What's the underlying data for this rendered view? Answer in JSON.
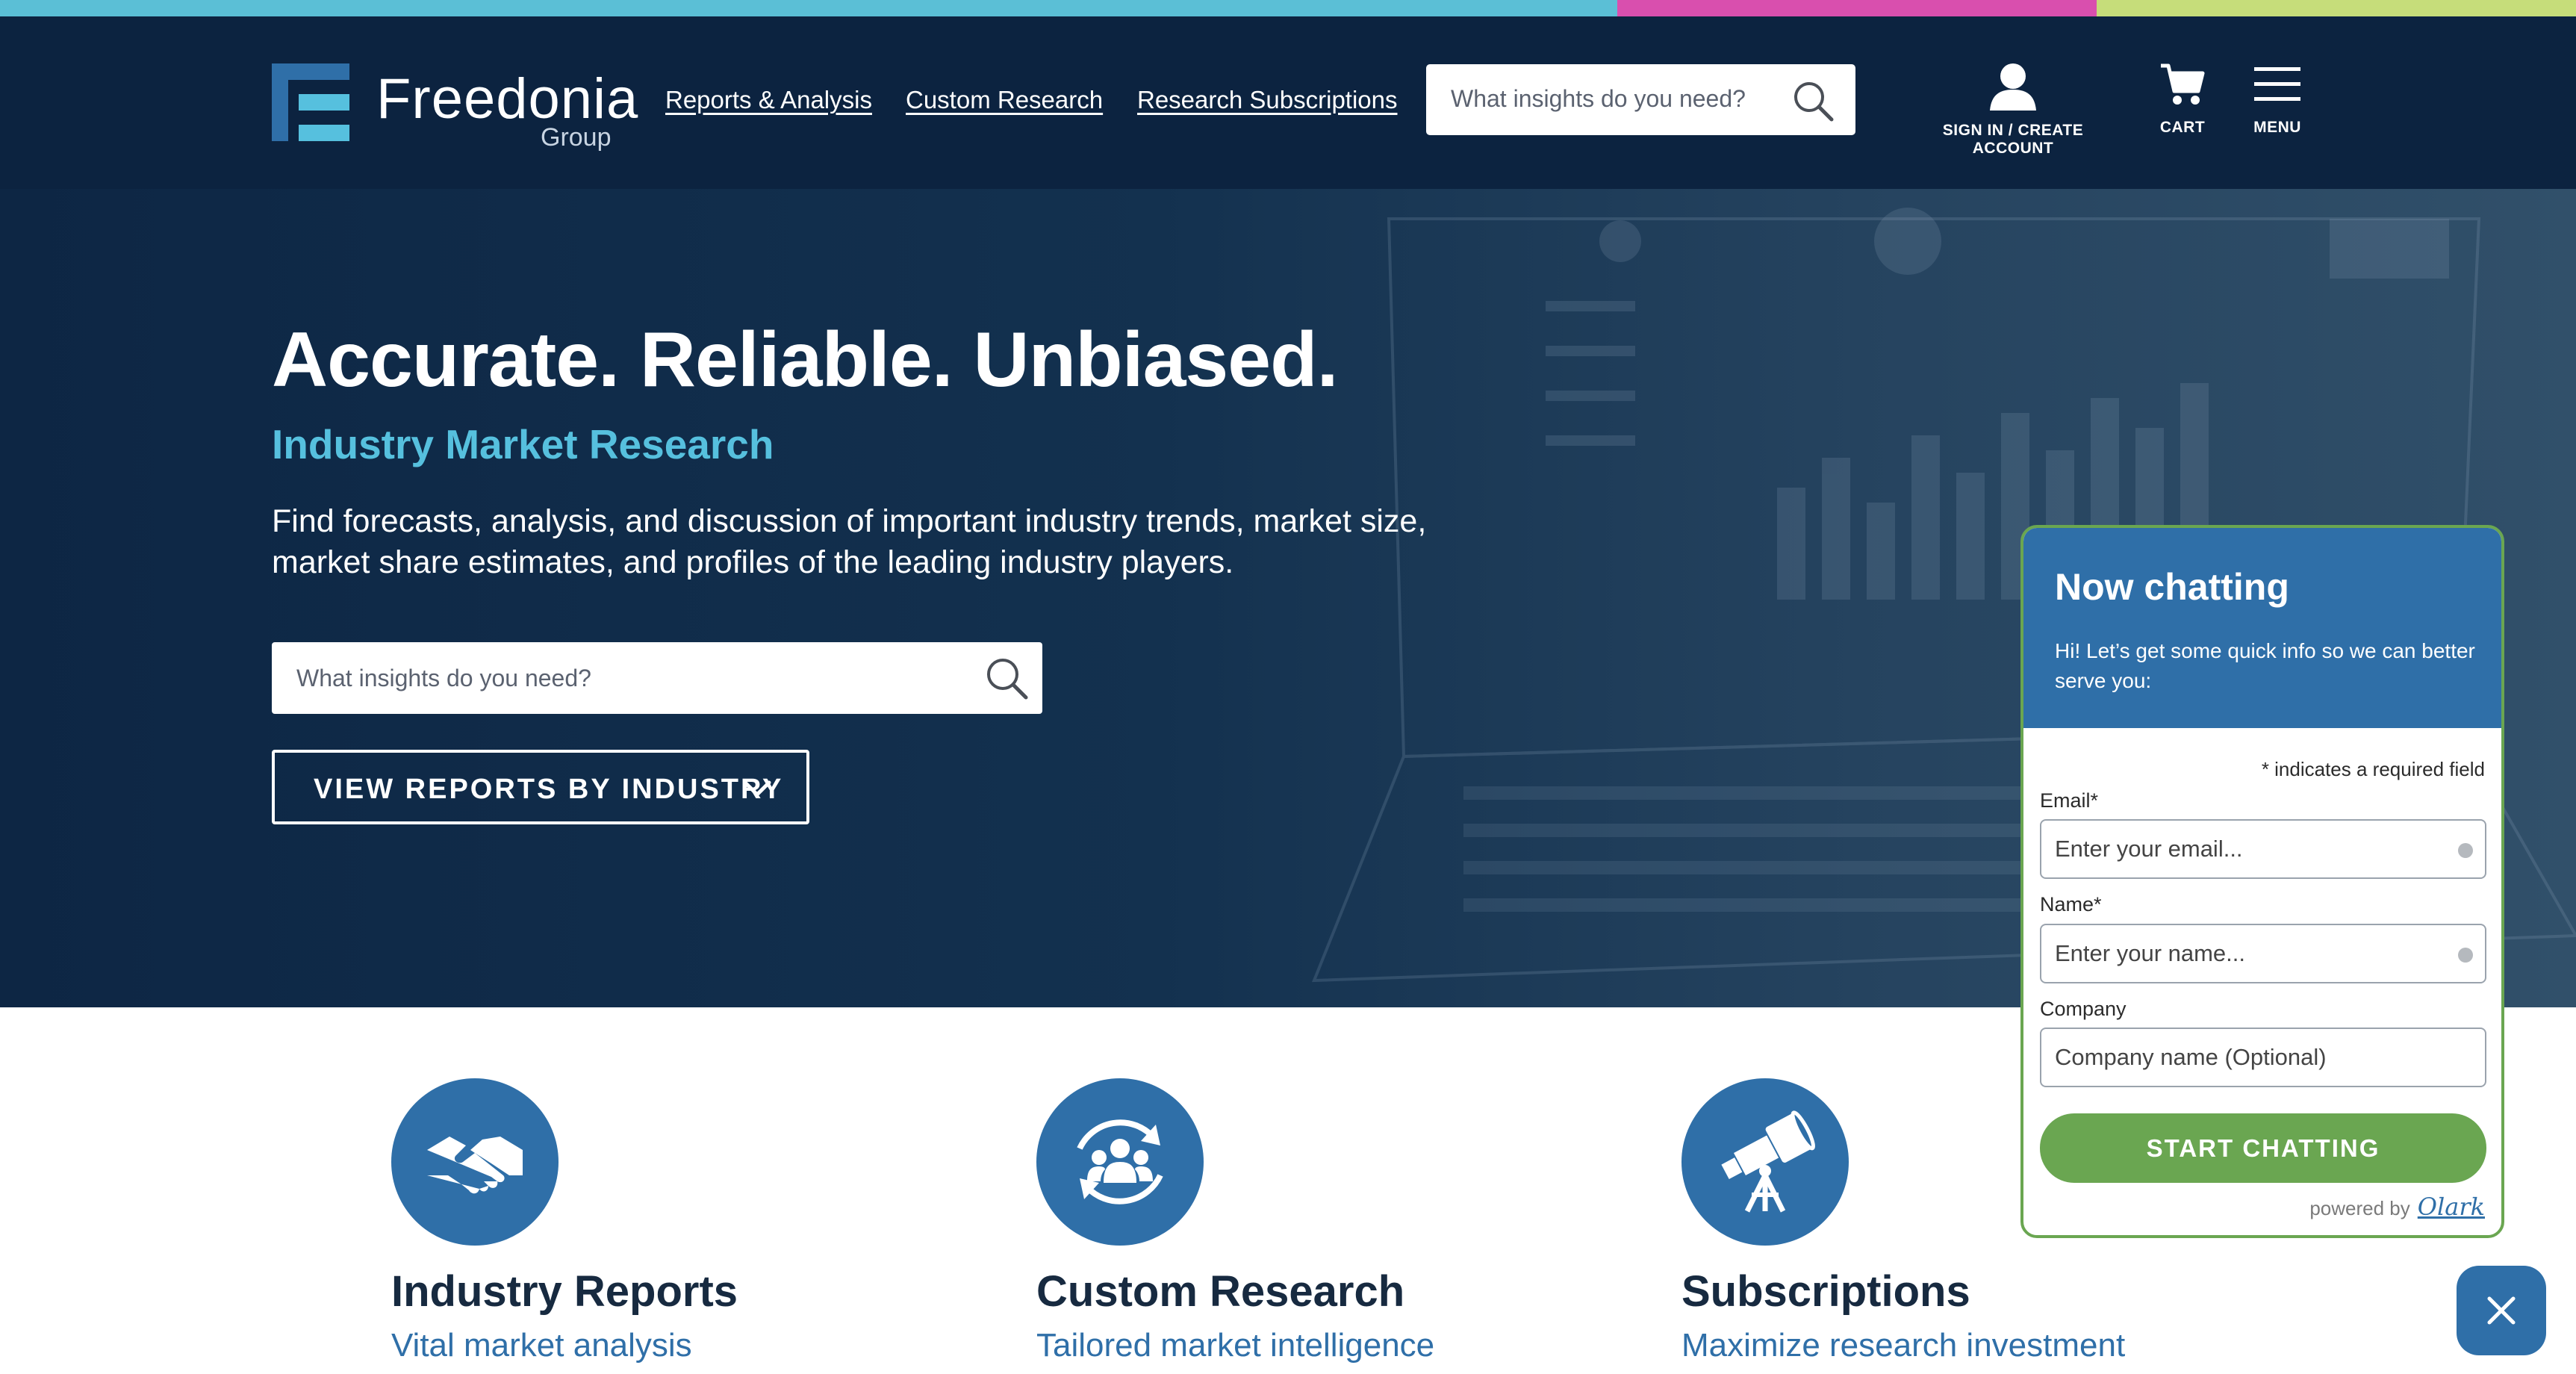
{
  "brand": {
    "name": "Freedonia",
    "sub": "Group"
  },
  "nav": [
    {
      "label": "Reports & Analysis"
    },
    {
      "label": "Custom Research"
    },
    {
      "label": "Research Subscriptions"
    }
  ],
  "header_search": {
    "placeholder": "What insights do you need?"
  },
  "header_actions": {
    "account": "SIGN IN / CREATE ACCOUNT",
    "cart": "CART",
    "menu": "MENU"
  },
  "hero": {
    "title": "Accurate. Reliable. Unbiased.",
    "subtitle": "Industry Market Research",
    "text": "Find forecasts, analysis, and discussion of important industry trends, market size, market share estimates, and profiles of the leading industry players.",
    "search_placeholder": "What insights do you need?",
    "industry_button": "VIEW REPORTS BY INDUSTRY"
  },
  "features": [
    {
      "title": "Industry Reports",
      "subtitle": "Vital market analysis",
      "icon": "handshake-icon"
    },
    {
      "title": "Custom Research",
      "subtitle": "Tailored market intelligence",
      "icon": "team-cycle-icon"
    },
    {
      "title": "Subscriptions",
      "subtitle": "Maximize research investment",
      "icon": "telescope-icon"
    }
  ],
  "chat": {
    "title": "Now chatting",
    "greeting": "Hi! Let’s get some quick info so we can better serve you:",
    "required_note": "* indicates a required field",
    "email_label": "Email*",
    "email_placeholder": "Enter your email...",
    "name_label": "Name*",
    "name_placeholder": "Enter your name...",
    "company_label": "Company",
    "company_placeholder": "Company name (Optional)",
    "start_button": "START CHATTING",
    "powered_by": "powered by",
    "powered_brand": "Olark"
  },
  "colors": {
    "header_bg": "#0c2340",
    "accent_blue": "#2f6fa8",
    "accent_cyan": "#56c0de",
    "chat_green": "#6aa651",
    "strip": [
      "#5bbfd6",
      "#d94fae",
      "#c6dd7a"
    ]
  }
}
